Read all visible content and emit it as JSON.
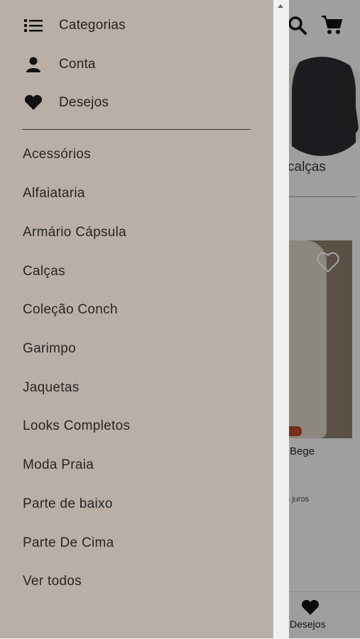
{
  "background": {
    "section_label": "calças",
    "product_name": "Bege",
    "installment_text": "n juros",
    "bottom_nav_label": "Desejos"
  },
  "drawer": {
    "top_items": [
      {
        "label": "Categorias",
        "icon": "list-icon"
      },
      {
        "label": "Conta",
        "icon": "user-icon"
      },
      {
        "label": "Desejos",
        "icon": "heart-icon"
      }
    ],
    "categories": [
      "Acessórios",
      "Alfaiataria",
      "Armário Cápsula",
      "Calças",
      "Coleção Conch",
      "Garimpo",
      "Jaquetas",
      "Looks Completos",
      "Moda Praia",
      "Parte de baixo",
      "Parte De Cima",
      "Ver todos"
    ]
  },
  "colors": {
    "drawer_bg": "#b9afa7",
    "text": "#262626"
  }
}
